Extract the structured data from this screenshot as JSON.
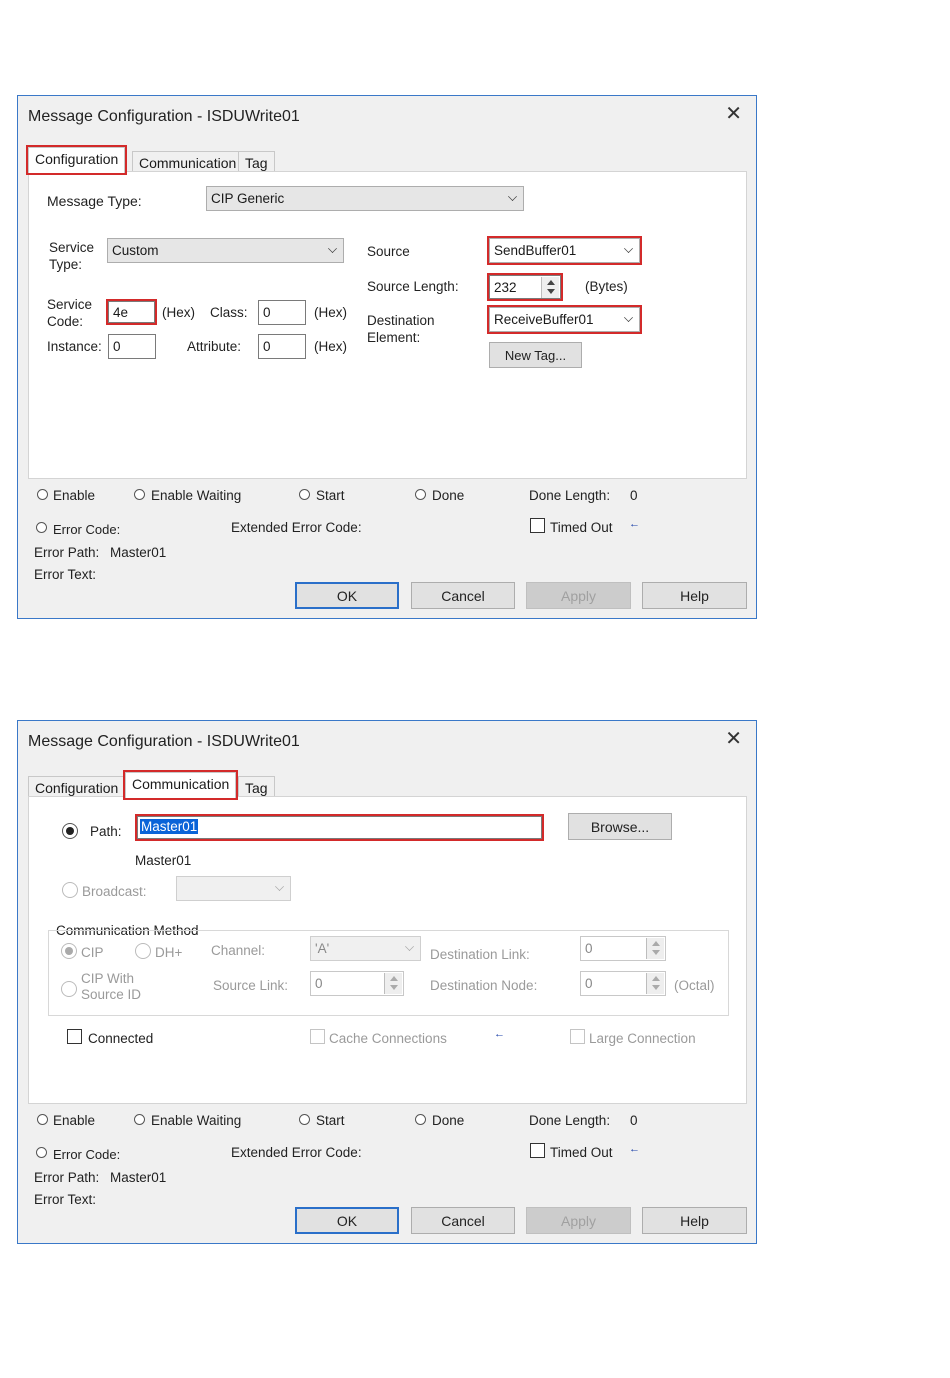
{
  "dialogs": [
    {
      "title": "Message Configuration - ISDUWrite01",
      "close_icon": "✕",
      "tabs": [
        "Configuration",
        "Communication",
        "Tag"
      ],
      "configuration": {
        "message_type_label": "Message Type:",
        "message_type_value": "CIP Generic",
        "service_type_label_1": "Service",
        "service_type_label_2": "Type:",
        "service_type_value": "Custom",
        "service_code_label_1": "Service",
        "service_code_label_2": "Code:",
        "service_code_value": "4e",
        "hex_label": "(Hex)",
        "class_label": "Class:",
        "class_value": "0",
        "instance_label": "Instance:",
        "instance_value": "0",
        "attribute_label": "Attribute:",
        "attribute_value": "0",
        "source_label": "Source",
        "source_value": "SendBuffer01",
        "source_length_label": "Source Length:",
        "source_length_value": "232",
        "bytes_label": "(Bytes)",
        "destination_label_1": "Destination",
        "destination_label_2": "Element:",
        "destination_value": "ReceiveBuffer01",
        "new_tag_button": "New Tag..."
      }
    },
    {
      "title": "Message Configuration - ISDUWrite01",
      "close_icon": "✕",
      "tabs": [
        "Configuration",
        "Communication",
        "Tag"
      ],
      "communication": {
        "path_label": "Path:",
        "path_value": "Master01",
        "path_resolved": "Master01",
        "browse_button": "Browse...",
        "broadcast_label": "Broadcast:",
        "comm_method_label": "Communication Method",
        "cip_label": "CIP",
        "dhplus_label": "DH+",
        "channel_label": "Channel:",
        "channel_value": "'A'",
        "destination_link_label": "Destination Link:",
        "destination_link_value": "0",
        "cip_with_source_id_1": "CIP With",
        "cip_with_source_id_2": "Source ID",
        "source_link_label": "Source Link:",
        "source_link_value": "0",
        "destination_node_label": "Destination Node:",
        "destination_node_value": "0",
        "octal_label": "(Octal)",
        "connected_label": "Connected",
        "cache_connections_label": "Cache Connections",
        "large_connection_label": "Large Connection"
      }
    }
  ],
  "status": {
    "enable": "Enable",
    "enable_waiting": "Enable Waiting",
    "start": "Start",
    "done": "Done",
    "done_length_label": "Done Length:",
    "done_length_value": "0",
    "error_code_label": "Error Code:",
    "extended_error_code_label": "Extended Error Code:",
    "timed_out_label": "Timed Out",
    "arrow_glyph": "←",
    "error_path_label": "Error Path:",
    "error_path_value": "Master01",
    "error_text_label": "Error Text:"
  },
  "buttons": {
    "ok": "OK",
    "cancel": "Cancel",
    "apply": "Apply",
    "help": "Help"
  },
  "colors": {
    "highlight_box": "#d32a2a",
    "dialog_border": "#3a78c8",
    "selection": "#0a64d8"
  }
}
